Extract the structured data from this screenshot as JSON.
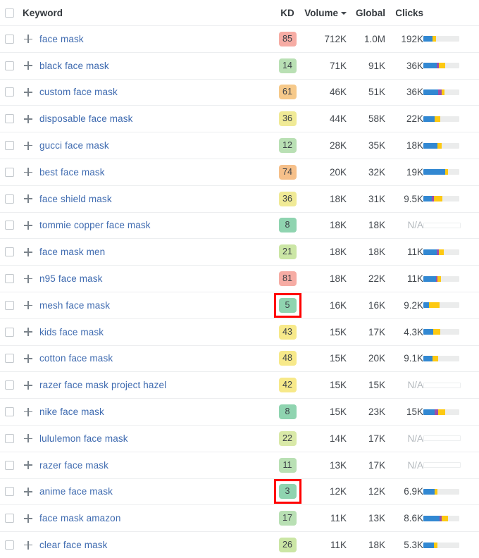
{
  "table": {
    "columns": {
      "select_all": "",
      "keyword": "Keyword",
      "kd": "KD",
      "volume": "Volume",
      "global": "Global",
      "clicks": "Clicks",
      "bar": ""
    },
    "sorted_by": "Volume",
    "sort_direction": "descending",
    "icons": {
      "sort_caret": "caret-down-icon",
      "expand": "plus-icon",
      "select": "checkbox-icon"
    },
    "colors": {
      "link": "#3f6bb0",
      "kd_very_easy": "#8fd4b0",
      "kd_easy": "#b9e0b4",
      "kd_possible": "#d9e9a8",
      "kd_medium": "#f7eb8a",
      "kd_difficult": "#f6c98a",
      "kd_hard": "#f6aca4",
      "bar_blue": "#3288d2",
      "bar_purple": "#9c4fa8",
      "bar_yellow": "#fdc912",
      "bar_track": "#ebecec",
      "highlight_box": "#ff0000"
    },
    "rows": [
      {
        "keyword": "face mask",
        "kd": "85",
        "kd_color": "#f6aca4",
        "volume": "712K",
        "global": "1.0M",
        "clicks": "192K",
        "highlight": false,
        "bar": {
          "empty": false,
          "blue": 26,
          "purple": 0,
          "yellow": 9
        }
      },
      {
        "keyword": "black face mask",
        "kd": "14",
        "kd_color": "#b9e0b4",
        "volume": "71K",
        "global": "91K",
        "clicks": "36K",
        "highlight": false,
        "bar": {
          "empty": false,
          "blue": 38,
          "purple": 6,
          "yellow": 17
        }
      },
      {
        "keyword": "custom face mask",
        "kd": "61",
        "kd_color": "#f6c98a",
        "volume": "46K",
        "global": "51K",
        "clicks": "36K",
        "highlight": false,
        "bar": {
          "empty": false,
          "blue": 42,
          "purple": 9,
          "yellow": 7
        }
      },
      {
        "keyword": "disposable face mask",
        "kd": "36",
        "kd_color": "#f0ea96",
        "volume": "44K",
        "global": "58K",
        "clicks": "22K",
        "highlight": false,
        "bar": {
          "empty": false,
          "blue": 31,
          "purple": 0,
          "yellow": 16
        }
      },
      {
        "keyword": "gucci face mask",
        "kd": "12",
        "kd_color": "#b9e0b4",
        "volume": "28K",
        "global": "35K",
        "clicks": "18K",
        "highlight": false,
        "bar": {
          "empty": false,
          "blue": 40,
          "purple": 0,
          "yellow": 11
        }
      },
      {
        "keyword": "best face mask",
        "kd": "74",
        "kd_color": "#f6c08a",
        "volume": "20K",
        "global": "32K",
        "clicks": "19K",
        "highlight": false,
        "bar": {
          "empty": false,
          "blue": 60,
          "purple": 0,
          "yellow": 9
        }
      },
      {
        "keyword": "face shield mask",
        "kd": "36",
        "kd_color": "#f0ea96",
        "volume": "18K",
        "global": "31K",
        "clicks": "9.5K",
        "highlight": false,
        "bar": {
          "empty": false,
          "blue": 24,
          "purple": 6,
          "yellow": 23
        }
      },
      {
        "keyword": "tommie copper face mask",
        "kd": "8",
        "kd_color": "#8fd4b0",
        "volume": "18K",
        "global": "18K",
        "clicks": "N/A",
        "highlight": false,
        "bar": {
          "empty": true,
          "blue": 0,
          "purple": 0,
          "yellow": 0
        }
      },
      {
        "keyword": "face mask men",
        "kd": "21",
        "kd_color": "#cbe6a5",
        "volume": "18K",
        "global": "18K",
        "clicks": "11K",
        "highlight": false,
        "bar": {
          "empty": false,
          "blue": 38,
          "purple": 5,
          "yellow": 14
        }
      },
      {
        "keyword": "n95 face mask",
        "kd": "81",
        "kd_color": "#f6aca4",
        "volume": "18K",
        "global": "22K",
        "clicks": "11K",
        "highlight": false,
        "bar": {
          "empty": false,
          "blue": 35,
          "purple": 5,
          "yellow": 9
        }
      },
      {
        "keyword": "mesh face mask",
        "kd": "5",
        "kd_color": "#8fd4b0",
        "volume": "16K",
        "global": "16K",
        "clicks": "9.2K",
        "highlight": true,
        "bar": {
          "empty": false,
          "blue": 16,
          "purple": 0,
          "yellow": 30
        }
      },
      {
        "keyword": "kids face mask",
        "kd": "43",
        "kd_color": "#f7e98a",
        "volume": "15K",
        "global": "17K",
        "clicks": "4.3K",
        "highlight": false,
        "bar": {
          "empty": false,
          "blue": 28,
          "purple": 0,
          "yellow": 19
        }
      },
      {
        "keyword": "cotton face mask",
        "kd": "48",
        "kd_color": "#f7e98a",
        "volume": "15K",
        "global": "20K",
        "clicks": "9.1K",
        "highlight": false,
        "bar": {
          "empty": false,
          "blue": 26,
          "purple": 0,
          "yellow": 16
        }
      },
      {
        "keyword": "razer face mask project hazel",
        "kd": "42",
        "kd_color": "#f7e98a",
        "volume": "15K",
        "global": "15K",
        "clicks": "N/A",
        "highlight": false,
        "bar": {
          "empty": true,
          "blue": 0,
          "purple": 0,
          "yellow": 0
        }
      },
      {
        "keyword": "nike face mask",
        "kd": "8",
        "kd_color": "#8fd4b0",
        "volume": "15K",
        "global": "23K",
        "clicks": "15K",
        "highlight": false,
        "bar": {
          "empty": false,
          "blue": 31,
          "purple": 10,
          "yellow": 19
        }
      },
      {
        "keyword": "lululemon face mask",
        "kd": "22",
        "kd_color": "#d9e9a8",
        "volume": "14K",
        "global": "17K",
        "clicks": "N/A",
        "highlight": false,
        "bar": {
          "empty": true,
          "blue": 0,
          "purple": 0,
          "yellow": 0
        }
      },
      {
        "keyword": "razer face mask",
        "kd": "11",
        "kd_color": "#b9e0b4",
        "volume": "13K",
        "global": "17K",
        "clicks": "N/A",
        "highlight": false,
        "bar": {
          "empty": true,
          "blue": 0,
          "purple": 0,
          "yellow": 0
        }
      },
      {
        "keyword": "anime face mask",
        "kd": "3",
        "kd_color": "#8fd4b0",
        "volume": "12K",
        "global": "12K",
        "clicks": "6.9K",
        "highlight": true,
        "bar": {
          "empty": false,
          "blue": 31,
          "purple": 0,
          "yellow": 9
        }
      },
      {
        "keyword": "face mask amazon",
        "kd": "17",
        "kd_color": "#b9e0b4",
        "volume": "11K",
        "global": "13K",
        "clicks": "8.6K",
        "highlight": false,
        "bar": {
          "empty": false,
          "blue": 46,
          "purple": 5,
          "yellow": 17
        }
      },
      {
        "keyword": "clear face mask",
        "kd": "26",
        "kd_color": "#cbe6a5",
        "volume": "11K",
        "global": "18K",
        "clicks": "5.3K",
        "highlight": false,
        "bar": {
          "empty": false,
          "blue": 30,
          "purple": 0,
          "yellow": 9
        }
      }
    ]
  }
}
